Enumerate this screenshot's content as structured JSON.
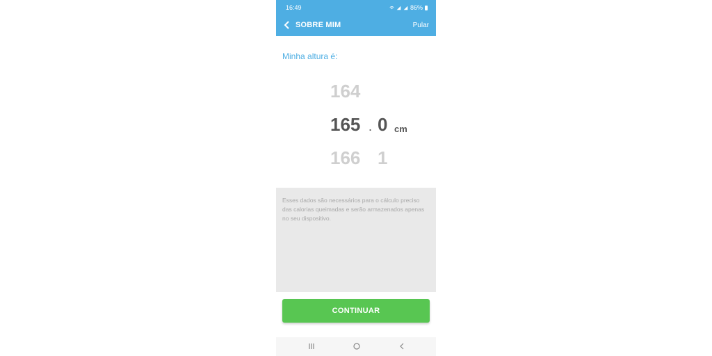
{
  "status_bar": {
    "time": "16:49",
    "battery": "86%"
  },
  "app_bar": {
    "title": "SOBRE MIM",
    "skip_label": "Pular"
  },
  "question": "Minha altura é:",
  "picker": {
    "integer_prev": "164",
    "integer_selected": "165",
    "integer_next": "166",
    "separator": ".",
    "decimal_selected": "0",
    "decimal_next": "1",
    "unit": "cm"
  },
  "info_text": "Esses dados são necessários para o cálculo preciso das calorias queimadas e serão armazenados apenas no seu dispositivo.",
  "continue_label": "CONTINUAR",
  "colors": {
    "primary": "#4eaee3",
    "button": "#58c652"
  },
  "icons": [
    "back-arrow-icon",
    "wifi-icon",
    "signal-icon",
    "battery-icon",
    "recent-apps-icon",
    "home-icon",
    "nav-back-icon"
  ]
}
